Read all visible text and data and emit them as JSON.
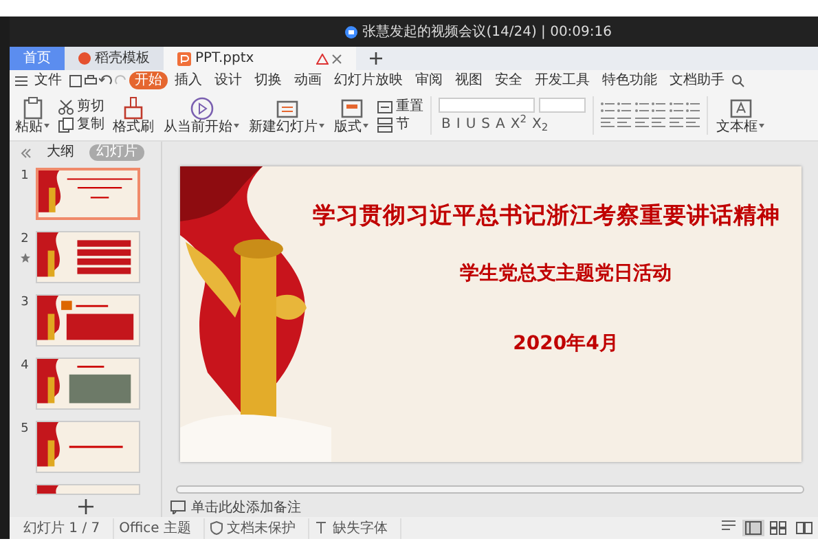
{
  "meeting_bar": {
    "text": "张慧发起的视频会议(14/24) | 00:09:16"
  },
  "tabs": [
    {
      "label": "首页",
      "selected": true,
      "kind": "home"
    },
    {
      "label": "稻壳模板",
      "selected": false,
      "kind": "docer"
    },
    {
      "label": "PPT.pptx",
      "selected": false,
      "kind": "file"
    }
  ],
  "menu": {
    "file": "文件",
    "tabs": [
      {
        "label": "开始",
        "selected": true
      },
      {
        "label": "插入",
        "selected": false
      },
      {
        "label": "设计",
        "selected": false
      },
      {
        "label": "切换",
        "selected": false
      },
      {
        "label": "动画",
        "selected": false
      },
      {
        "label": "幻灯片放映",
        "selected": false
      },
      {
        "label": "审阅",
        "selected": false
      },
      {
        "label": "视图",
        "selected": false
      },
      {
        "label": "安全",
        "selected": false
      },
      {
        "label": "开发工具",
        "selected": false
      },
      {
        "label": "特色功能",
        "selected": false
      },
      {
        "label": "文档助手",
        "selected": false
      }
    ]
  },
  "ribbon": [
    {
      "kind": "big",
      "label": "粘贴",
      "dropdown": true
    },
    {
      "kind": "stack",
      "items": [
        {
          "label": "剪切"
        },
        {
          "label": "复制"
        }
      ]
    },
    {
      "kind": "big",
      "label": "格式刷",
      "dropdown": false
    },
    {
      "kind": "big",
      "label": "从当前开始",
      "dropdown": true
    },
    {
      "kind": "big",
      "label": "新建幻灯片",
      "dropdown": true
    },
    {
      "kind": "big",
      "label": "版式",
      "dropdown": true
    },
    {
      "kind": "stack",
      "items": [
        {
          "label": "重置"
        },
        {
          "label": "节"
        }
      ]
    },
    {
      "kind": "font",
      "buttons": [
        "B",
        "I",
        "U",
        "S",
        "A",
        "X$^{2}$",
        "X$_{2}$"
      ]
    },
    {
      "kind": "paragraph"
    },
    {
      "kind": "big",
      "label": "文本框",
      "dropdown": true
    }
  ],
  "side_panel": {
    "tabs": [
      {
        "label": "大纲",
        "selected": false
      },
      {
        "label": "幻灯片",
        "selected": true
      }
    ],
    "slides": [
      {
        "number": "1",
        "selected": true,
        "animated": false,
        "kind": "title"
      },
      {
        "number": "2",
        "selected": false,
        "animated": true,
        "kind": "agenda"
      },
      {
        "number": "3",
        "selected": false,
        "animated": false,
        "kind": "text"
      },
      {
        "number": "4",
        "selected": false,
        "animated": false,
        "kind": "photo"
      },
      {
        "number": "5",
        "selected": false,
        "animated": false,
        "kind": "heading"
      },
      {
        "selected": false,
        "animated": false,
        "kind": "partial"
      }
    ]
  },
  "slide": {
    "title": "学习贯彻习近平总书记浙江考察重要讲话精神",
    "subtitle": "学生党总支主题党日活动",
    "date": "2020年4月"
  },
  "notes": {
    "placeholder": "单击此处添加备注"
  },
  "status_bar": {
    "items": [
      {
        "label": "幻灯片 1 / 7",
        "kind": "plain"
      },
      {
        "label": "Office 主题",
        "kind": "plain"
      },
      {
        "label": "文档未保护",
        "kind": "shield"
      },
      {
        "label": "缺失字体",
        "kind": "font"
      }
    ],
    "views": [
      {
        "kind": "normal",
        "selected": true
      },
      {
        "kind": "sorter",
        "selected": false
      },
      {
        "kind": "reading",
        "selected": false
      }
    ]
  }
}
